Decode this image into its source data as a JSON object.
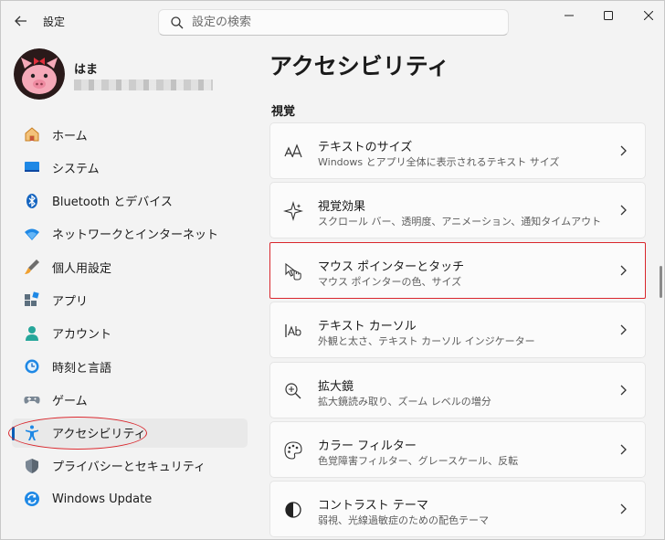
{
  "window": {
    "title": "設定",
    "search_placeholder": "設定の検索"
  },
  "profile": {
    "name": "はま"
  },
  "sidebar": {
    "items": [
      {
        "label": "ホーム",
        "icon": "home-icon"
      },
      {
        "label": "システム",
        "icon": "system-icon"
      },
      {
        "label": "Bluetooth とデバイス",
        "icon": "bluetooth-icon"
      },
      {
        "label": "ネットワークとインターネット",
        "icon": "wifi-icon"
      },
      {
        "label": "個人用設定",
        "icon": "brush-icon"
      },
      {
        "label": "アプリ",
        "icon": "apps-icon"
      },
      {
        "label": "アカウント",
        "icon": "account-icon"
      },
      {
        "label": "時刻と言語",
        "icon": "time-language-icon"
      },
      {
        "label": "ゲーム",
        "icon": "gamepad-icon"
      },
      {
        "label": "アクセシビリティ",
        "icon": "accessibility-icon",
        "selected": true
      },
      {
        "label": "プライバシーとセキュリティ",
        "icon": "shield-icon"
      },
      {
        "label": "Windows Update",
        "icon": "update-icon"
      }
    ]
  },
  "main": {
    "title": "アクセシビリティ",
    "section": "視覚",
    "cards": [
      {
        "title": "テキストのサイズ",
        "subtitle": "Windows とアプリ全体に表示されるテキスト サイズ",
        "icon": "text-size-icon"
      },
      {
        "title": "視覚効果",
        "subtitle": "スクロール バー、透明度、アニメーション、通知タイムアウト",
        "icon": "visual-effects-icon"
      },
      {
        "title": "マウス ポインターとタッチ",
        "subtitle": "マウス ポインターの色、サイズ",
        "icon": "mouse-pointer-icon",
        "highlighted": true
      },
      {
        "title": "テキスト カーソル",
        "subtitle": "外観と太さ、テキスト カーソル インジケーター",
        "icon": "text-cursor-icon"
      },
      {
        "title": "拡大鏡",
        "subtitle": "拡大鏡読み取り、ズーム レベルの増分",
        "icon": "magnifier-icon"
      },
      {
        "title": "カラー フィルター",
        "subtitle": "色覚障害フィルター、グレースケール、反転",
        "icon": "color-filter-icon"
      },
      {
        "title": "コントラスト テーマ",
        "subtitle": "弱視、光線過敏症のための配色テーマ",
        "icon": "contrast-icon"
      }
    ]
  },
  "colors": {
    "accent": "#005fb8",
    "highlight_red": "#d9262c"
  }
}
